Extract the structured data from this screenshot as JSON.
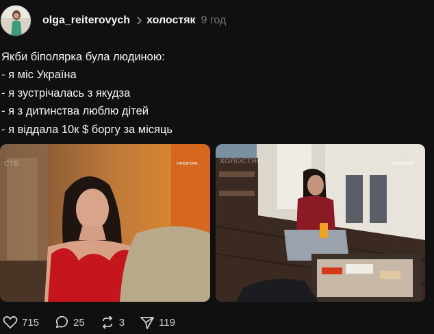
{
  "post": {
    "author": "olga_reiterovych",
    "topic": "холостяк",
    "time": "9 год",
    "text_lines": [
      "Якби біполярка була людиною:",
      "- я міс Україна",
      "- я зустрічалась з якудза",
      "- я з дитинства люблю дітей",
      "- я віддала 10к $ боргу за місяць"
    ]
  },
  "images": [
    {
      "watermark": "СТБ",
      "badge": "ПРЕМ'ЄРА"
    },
    {
      "watermark": "ХОЛОСТЯК",
      "badge": "ПРЕМ'ЄРА"
    }
  ],
  "actions": {
    "likes": "715",
    "comments": "25",
    "reposts": "3",
    "shares": "119"
  },
  "icons": [
    "heart-icon",
    "comment-icon",
    "repost-icon",
    "share-icon",
    "chevron-right-icon"
  ],
  "colors": {
    "background": "#101010",
    "text": "#f3f5f7",
    "muted": "#777777"
  }
}
